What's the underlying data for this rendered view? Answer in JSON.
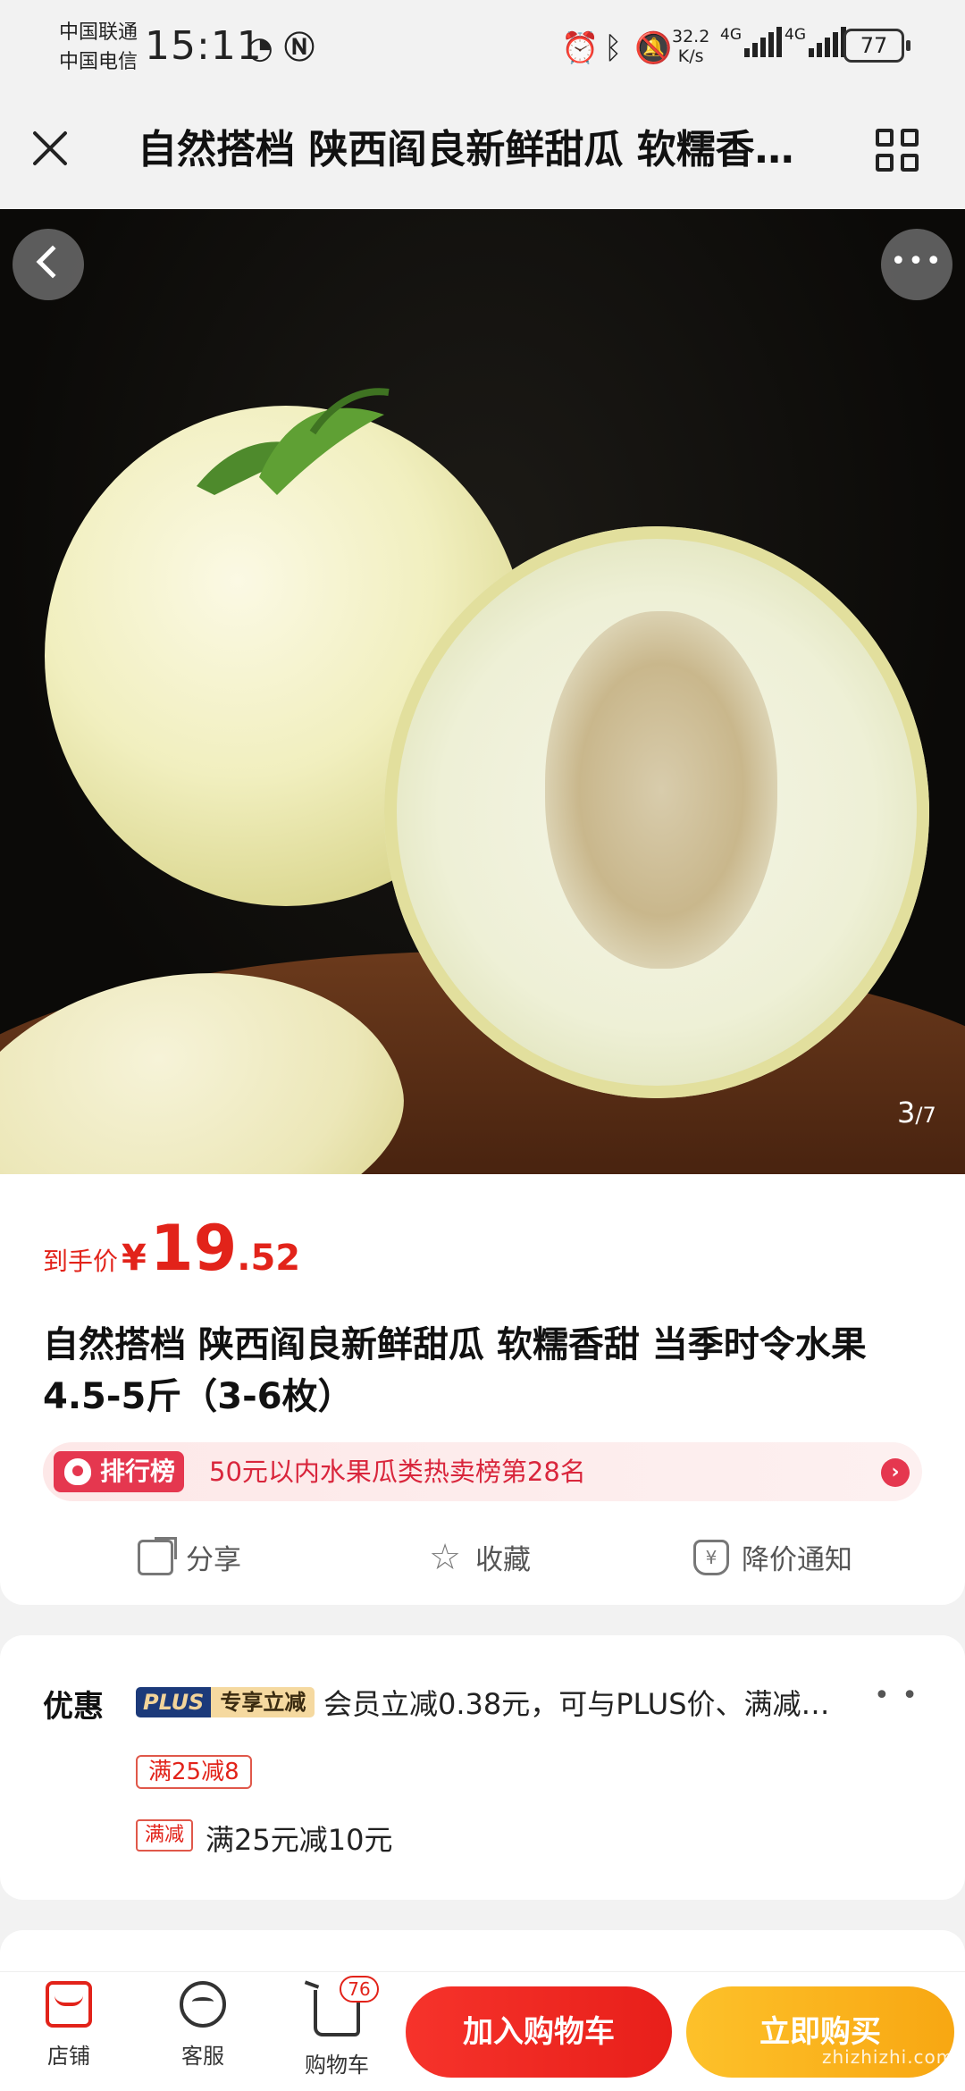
{
  "status": {
    "carrier1": "中国联通",
    "carrier2": "中国电信",
    "time": "15:11",
    "net_speed_value": "32.2",
    "net_speed_unit": "K/s",
    "network1": "4G",
    "network2": "4G",
    "battery": "77"
  },
  "header": {
    "title": "自然搭档 陕西阎良新鲜甜瓜 软糯香甜 当季时令水果"
  },
  "gallery": {
    "current": "3",
    "total": "/7"
  },
  "price": {
    "label": "到手价",
    "currency": "¥",
    "integer": "19",
    "decimal": ".52"
  },
  "product": {
    "title": "自然搭档 陕西阎良新鲜甜瓜 软糯香甜 当季时令水果 4.5-5斤（3-6枚）"
  },
  "ranking": {
    "tag": "排行榜",
    "text": "50元以内水果瓜类热卖榜第28名",
    "arrow": "›"
  },
  "actions": {
    "share": "分享",
    "favorite": "收藏",
    "price_alert": "降价通知"
  },
  "coupons": {
    "title": "优惠",
    "plus_label": "PLUS",
    "plus_tag": "专享立减",
    "plus_text": "会员立减0.38元，可与PLUS价、满减…",
    "more": "• •",
    "tag1": "满25减8",
    "tag2": "满减",
    "line3": "满25元减10元"
  },
  "bottom": {
    "shop": "店铺",
    "service": "客服",
    "cart": "购物车",
    "cart_count": "76",
    "add_to_cart": "加入购物车",
    "buy_now": "立即购买"
  },
  "watermark": "zhizhizhi.com",
  "colors": {
    "price_red": "#e2231a",
    "buy_yellow": "#f8a712",
    "plus_navy": "#1c3a7a"
  }
}
